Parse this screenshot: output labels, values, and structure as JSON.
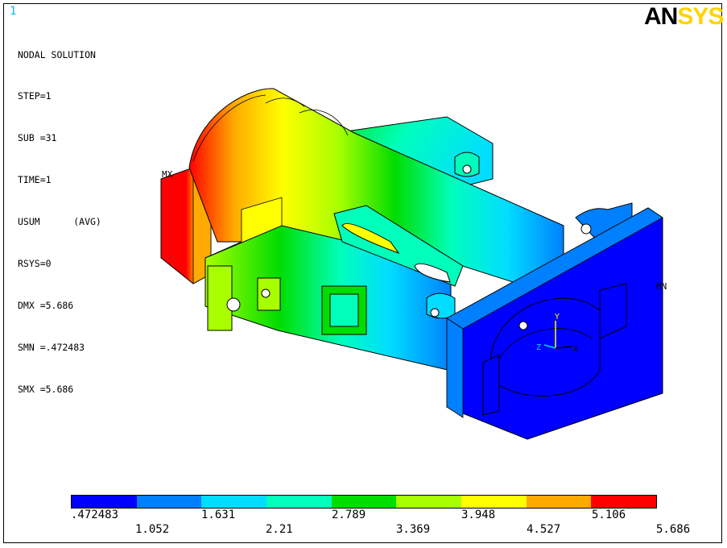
{
  "window_number": "1",
  "header": {
    "title": "NODAL SOLUTION",
    "lines": [
      "STEP=1",
      "SUB =31",
      "TIME=1",
      "USUM      (AVG)",
      "RSYS=0",
      "DMX =5.686",
      "SMN =.472483",
      "SMX =5.686"
    ]
  },
  "logo": {
    "part1": "AN",
    "part2": "SYS"
  },
  "markers": {
    "max": "MX",
    "min": "MN"
  },
  "triad": {
    "x": "X",
    "y": "Y",
    "z": "Z"
  },
  "legend": {
    "colors": [
      "#0000ff",
      "#0080ff",
      "#00ddff",
      "#00ffbb",
      "#00dd00",
      "#a8ff00",
      "#ffff00",
      "#ffaa00",
      "#ff0000"
    ],
    "top_labels": [
      ".472483",
      "1.631",
      "2.789",
      "3.948",
      "5.106"
    ],
    "bottom_labels": [
      "1.052",
      "2.21",
      "3.369",
      "4.527",
      "5.686"
    ]
  }
}
